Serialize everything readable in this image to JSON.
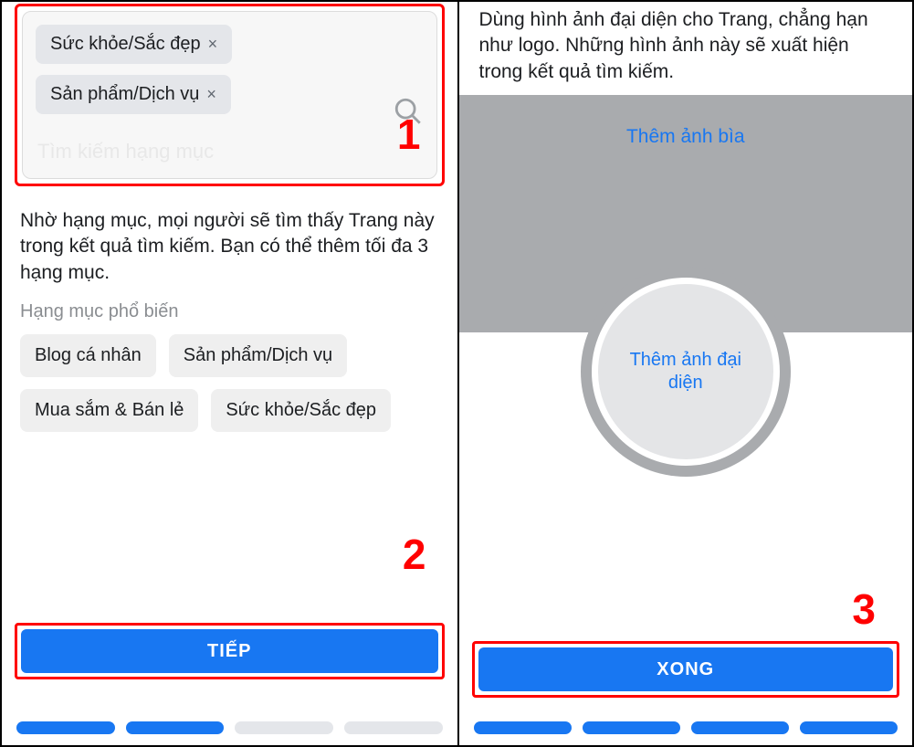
{
  "left": {
    "chips": [
      "Sức khỏe/Sắc đẹp",
      "Sản phẩm/Dịch vụ"
    ],
    "search_placeholder": "Tìm kiếm hạng mục",
    "help": "Nhờ hạng mục, mọi người sẽ tìm thấy Trang này trong kết quả tìm kiếm. Bạn có thể thêm tối đa 3 hạng mục.",
    "popular_label": "Hạng mục phổ biến",
    "popular_row1": [
      "Blog cá nhân",
      "Sản phẩm/Dịch vụ"
    ],
    "popular_row2": [
      "Mua sắm & Bán lẻ",
      "Sức khỏe/Sắc đẹp"
    ],
    "primary": "TIẾP",
    "progress": [
      "on",
      "on",
      "off",
      "off"
    ]
  },
  "right": {
    "help": "Dùng hình ảnh đại diện cho Trang, chẳng hạn như logo. Những hình ảnh này sẽ xuất hiện trong kết quả tìm kiếm.",
    "cover_link": "Thêm ảnh bìa",
    "avatar_link": "Thêm ảnh đại diện",
    "primary": "XONG",
    "progress": [
      "on",
      "on",
      "on",
      "on"
    ]
  },
  "annotations": {
    "n1": "1",
    "n2": "2",
    "n3": "3"
  }
}
